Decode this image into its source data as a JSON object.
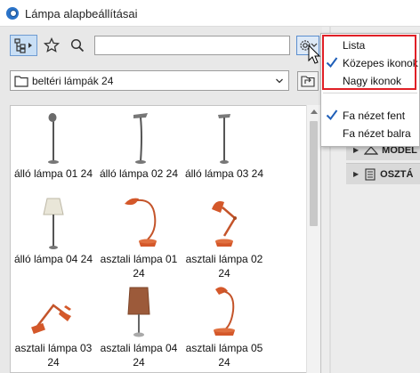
{
  "window": {
    "title": "Lámpa alapbeállításai"
  },
  "toolbar": {
    "tree_icon": "tree-view-icon",
    "favorites_icon": "star-icon",
    "search_icon": "search-icon",
    "search_value": "",
    "settings_icon": "gear-icon"
  },
  "folder": {
    "selected": "beltéri lámpák 24",
    "icon": "folder-icon",
    "up_icon": "folder-up-icon"
  },
  "items": [
    {
      "label": "álló lámpa 01 24",
      "icon": "floor-lamp-icon"
    },
    {
      "label": "álló lámpa 02 24",
      "icon": "floor-lamp-icon"
    },
    {
      "label": "álló lámpa 03 24",
      "icon": "floor-lamp-icon"
    },
    {
      "label": "álló lámpa 04 24",
      "icon": "floor-lamp-shade-icon"
    },
    {
      "label": "asztali lámpa 01 24",
      "icon": "desk-lamp-icon"
    },
    {
      "label": "asztali lámpa 02 24",
      "icon": "desk-lamp-icon"
    },
    {
      "label": "asztali lámpa 03 24",
      "icon": "desk-lamp-icon"
    },
    {
      "label": "asztali lámpa 04 24",
      "icon": "table-lamp-icon"
    },
    {
      "label": "asztali lámpa 05 24",
      "icon": "desk-lamp-icon"
    }
  ],
  "menu": {
    "view_items": [
      {
        "label": "Lista",
        "checked": false
      },
      {
        "label": "Közepes ikonok",
        "checked": true
      },
      {
        "label": "Nagy ikonok",
        "checked": false
      }
    ],
    "tree_items": [
      {
        "label": "Fa nézet fent",
        "checked": true
      },
      {
        "label": "Fa nézet balra",
        "checked": false
      }
    ]
  },
  "right_panel": {
    "rows": [
      {
        "label": "MODEL",
        "icon": "model-icon"
      },
      {
        "label": "OSZTÁ",
        "icon": "classification-icon"
      }
    ]
  },
  "colors": {
    "accent": "#2b73c8",
    "highlight_border": "#e01f26",
    "lamp_orange": "#d4582a"
  }
}
